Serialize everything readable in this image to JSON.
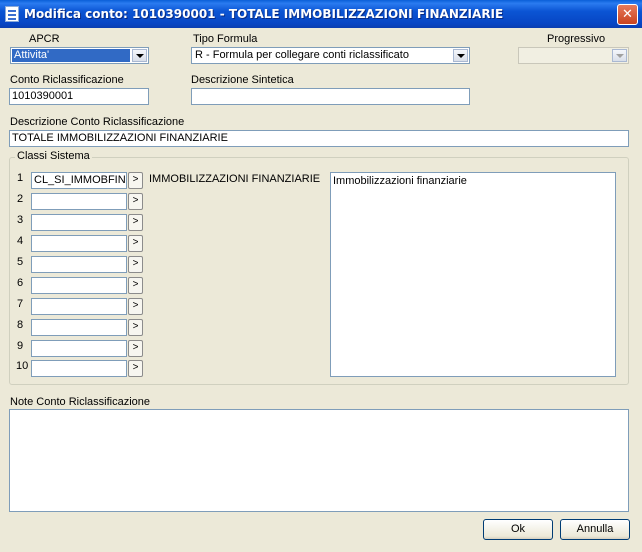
{
  "window": {
    "title": "Modifica conto: 1010390001 - TOTALE IMMOBILIZZAZIONI FINANZIARIE",
    "close_glyph": "✕"
  },
  "apcr": {
    "label": "APCR",
    "value": "Attivita'"
  },
  "tipo_formula": {
    "label": "Tipo Formula",
    "value": "R - Formula per collegare conti riclassificato"
  },
  "progressivo": {
    "label": "Progressivo",
    "value": ""
  },
  "conto": {
    "label": "Conto Riclassificazione",
    "value": "1010390001"
  },
  "descr_sintetica": {
    "label": "Descrizione Sintetica",
    "value": ""
  },
  "descr_conto": {
    "label": "Descrizione Conto Riclassificazione",
    "value": "TOTALE IMMOBILIZZAZIONI FINANZIARIE"
  },
  "classi": {
    "label": "Classi Sistema",
    "rows": [
      {
        "num": "1",
        "value": "CL_SI_IMMOBFIN"
      },
      {
        "num": "2",
        "value": ""
      },
      {
        "num": "3",
        "value": ""
      },
      {
        "num": "4",
        "value": ""
      },
      {
        "num": "5",
        "value": ""
      },
      {
        "num": "6",
        "value": ""
      },
      {
        "num": "7",
        "value": ""
      },
      {
        "num": "8",
        "value": ""
      },
      {
        "num": "9",
        "value": ""
      },
      {
        "num": "10",
        "value": ""
      }
    ],
    "go_label": ">",
    "first_desc": "IMMOBILIZZAZIONI FINANZIARIE",
    "list_items": [
      "Immobilizzazioni finanziarie"
    ]
  },
  "note": {
    "label": "Note Conto Riclassificazione",
    "value": ""
  },
  "buttons": {
    "ok": "Ok",
    "annulla": "Annulla"
  },
  "colors": {
    "title_bar": "#0b55d4",
    "selection": "#316ac5",
    "dialog_bg": "#ece9d8"
  }
}
